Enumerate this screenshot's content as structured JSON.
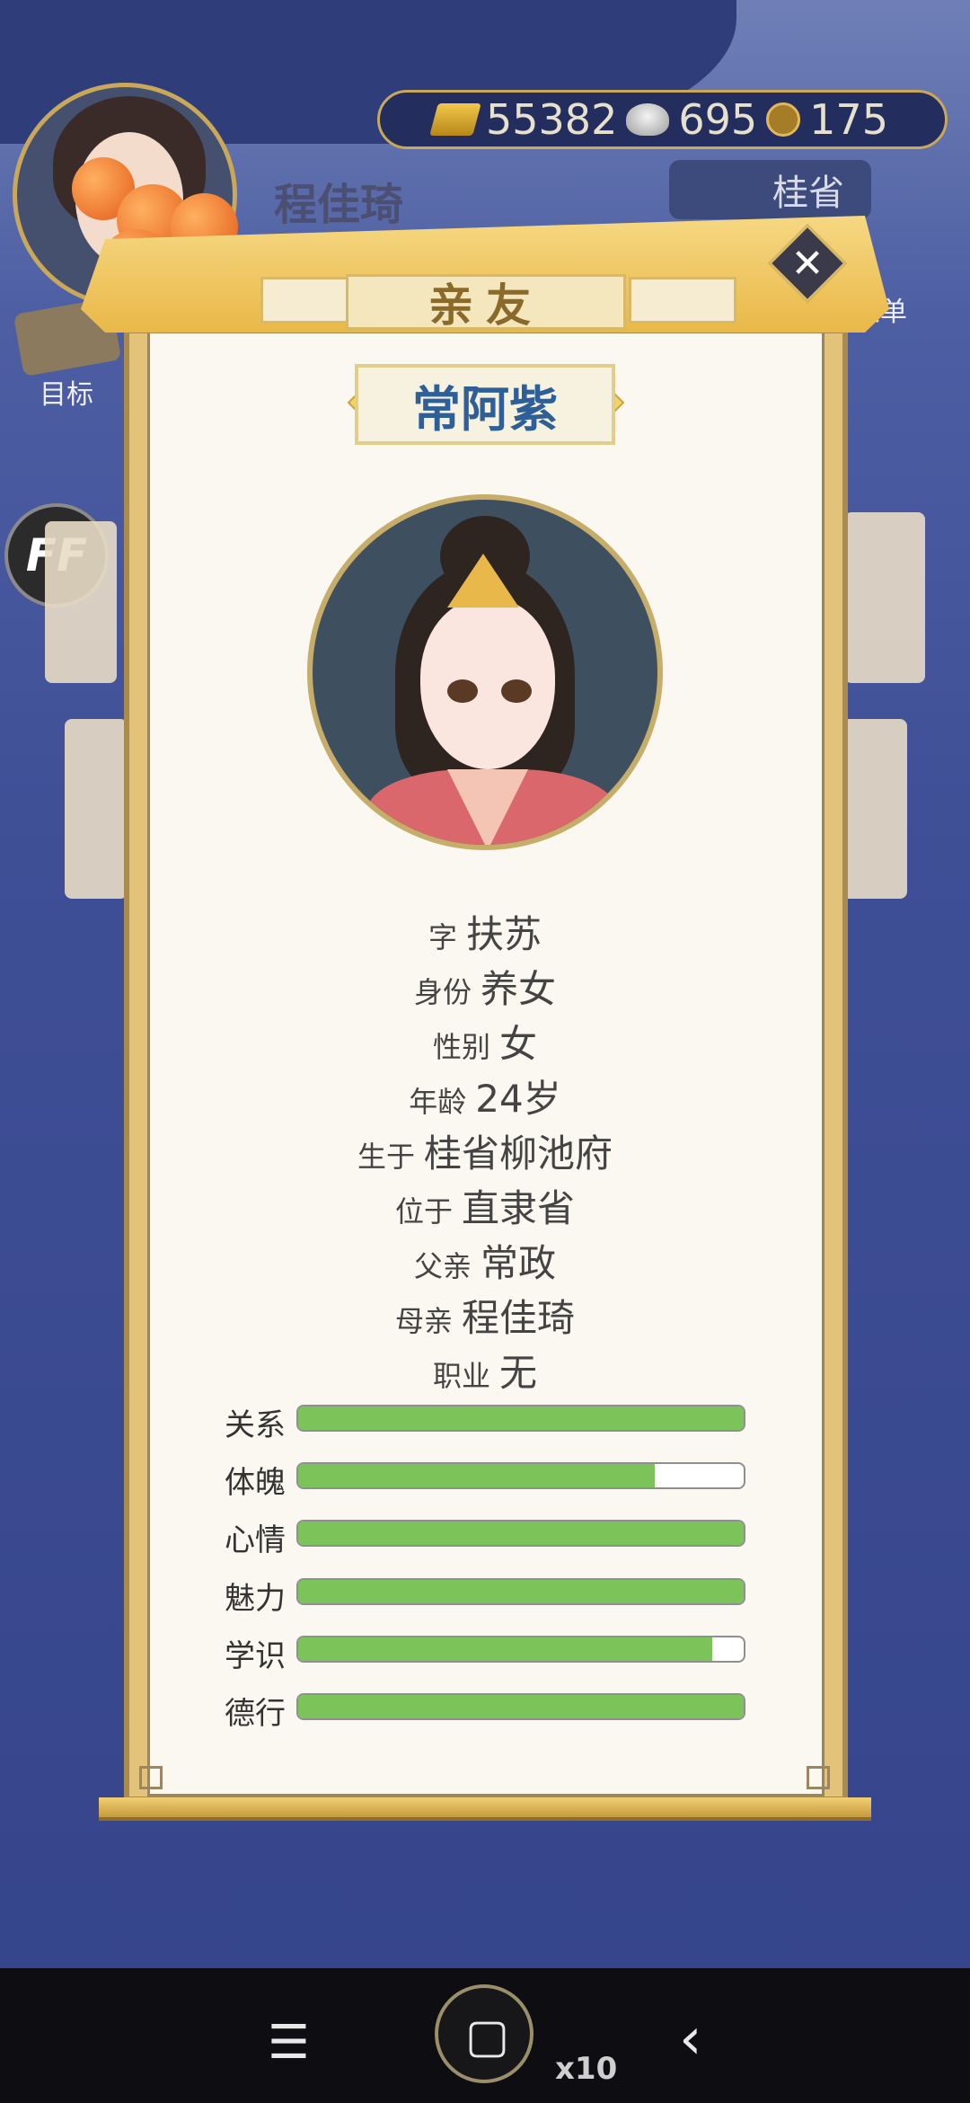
{
  "header": {
    "player_name": "程佳琦",
    "currency": {
      "gold": "55382",
      "silver": "695",
      "coin": "175"
    },
    "region_button": "桂省",
    "menu_label": "菜单",
    "goal_label": "目标",
    "ff_label": "FF"
  },
  "dialog": {
    "title": "亲友",
    "close": "✕",
    "person_name": "常阿紫",
    "info": [
      {
        "key": "字",
        "value": "扶苏"
      },
      {
        "key": "身份",
        "value": "养女"
      },
      {
        "key": "性别",
        "value": "女"
      },
      {
        "key": "年龄",
        "value": "24岁"
      },
      {
        "key": "生于",
        "value": "桂省柳池府"
      },
      {
        "key": "位于",
        "value": "直隶省"
      },
      {
        "key": "父亲",
        "value": "常政"
      },
      {
        "key": "母亲",
        "value": "程佳琦"
      },
      {
        "key": "职业",
        "value": "无"
      }
    ],
    "stats": [
      {
        "label": "关系",
        "value": 1.0
      },
      {
        "label": "体魄",
        "value": 0.8
      },
      {
        "label": "心情",
        "value": 1.0
      },
      {
        "label": "魅力",
        "value": 1.0
      },
      {
        "label": "学识",
        "value": 0.93
      },
      {
        "label": "德行",
        "value": 1.0
      }
    ]
  },
  "navbar": {
    "menu_icon": "☰",
    "home_icon": "▢",
    "back_icon": "‹",
    "float_count": "x10"
  },
  "colors": {
    "stat_fill": "#7cc35a",
    "name_text": "#2f5f97",
    "panel_gold": "#e3c27a"
  }
}
